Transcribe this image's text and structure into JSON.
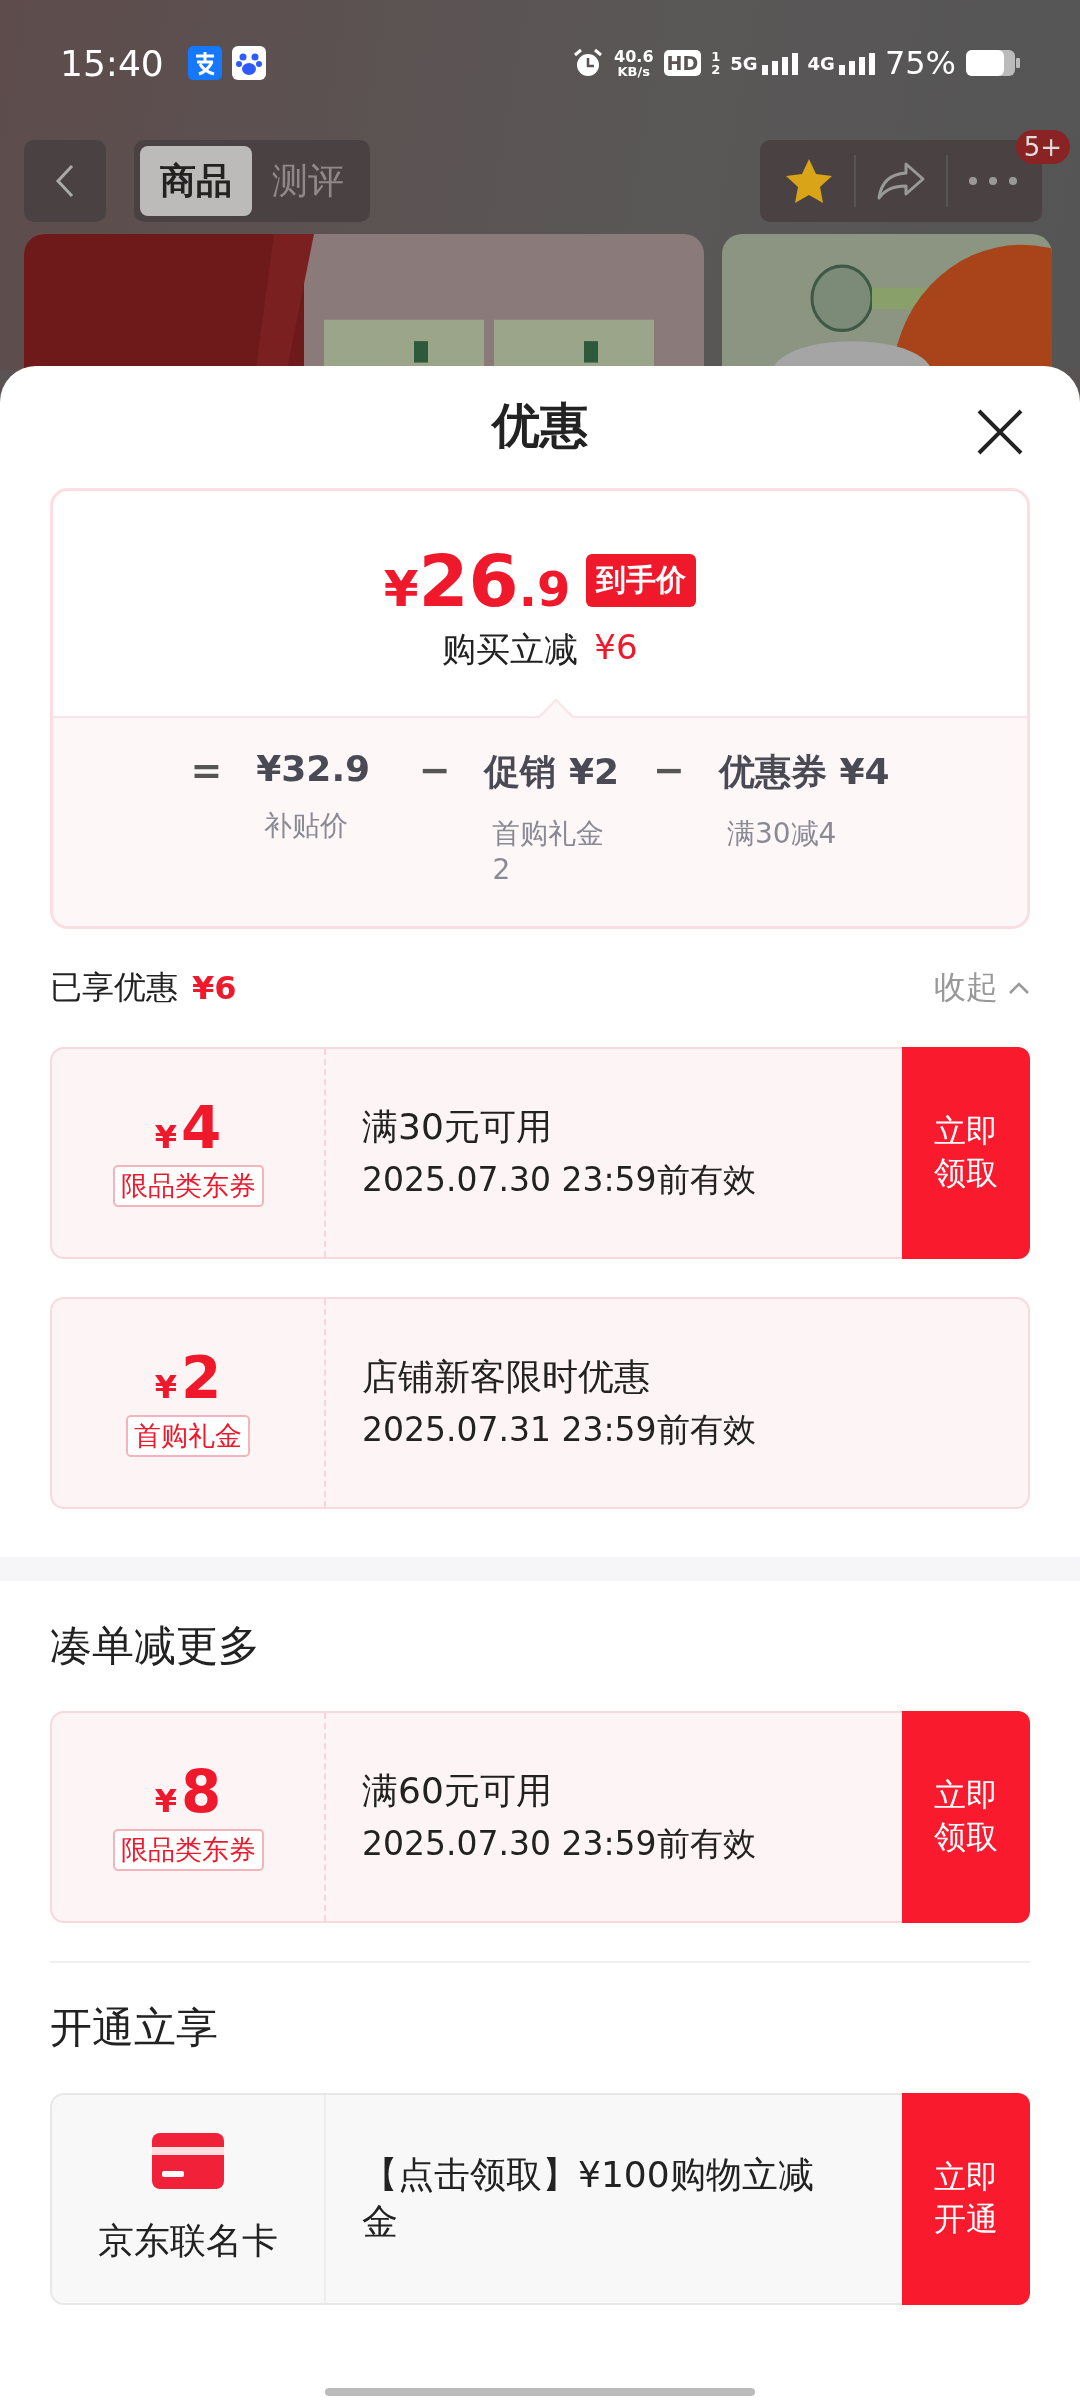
{
  "status_bar": {
    "time": "15:40",
    "net_speed": "40.6",
    "net_unit": "KB/s",
    "hd": "HD",
    "sim_1": "1",
    "sim_2": "2",
    "network_1": "5G",
    "network_2": "4G",
    "battery": "75%"
  },
  "nav": {
    "tabs": [
      {
        "label": "商品",
        "selected": true
      },
      {
        "label": "测评",
        "selected": false
      }
    ],
    "favorited": true,
    "badge": "5+"
  },
  "sheet": {
    "title": "优惠",
    "price": {
      "currency": "¥",
      "integer": "26",
      "decimal": ".9",
      "tag": "到手价",
      "saving_label": "购买立减",
      "saving": "¥6"
    },
    "breakdown": {
      "equals": "=",
      "terms": [
        {
          "value": "¥32.9",
          "note": "补贴价"
        },
        {
          "operator": "−",
          "value": "促销 ¥2",
          "note": "首购礼金2"
        },
        {
          "operator": "−",
          "value": "优惠券 ¥4",
          "note": "满30减4"
        }
      ]
    },
    "enjoyed": {
      "label": "已享优惠",
      "amount": "¥6",
      "toggle": "收起",
      "expanded": true
    },
    "coupons": [
      {
        "kind": "coupon",
        "currency": "¥",
        "amount": "4",
        "tag": "限品类东券",
        "title": "满30元可用",
        "validity": "2025.07.30 23:59前有效",
        "action": "立即领取"
      },
      {
        "kind": "coupon",
        "currency": "¥",
        "amount": "2",
        "tag": "首购礼金",
        "title": "店铺新客限时优惠",
        "validity": "2025.07.31 23:59前有效"
      }
    ],
    "sections": [
      {
        "title": "凑单减更多",
        "items": [
          {
            "kind": "coupon",
            "currency": "¥",
            "amount": "8",
            "tag": "限品类东券",
            "title": "满60元可用",
            "validity": "2025.07.30 23:59前有效",
            "action": "立即领取"
          }
        ]
      },
      {
        "title": "开通立享",
        "items": [
          {
            "kind": "card",
            "name": "京东联名卡",
            "title": "【点击领取】¥100购物立减金",
            "action": "立即开通"
          }
        ]
      }
    ]
  }
}
